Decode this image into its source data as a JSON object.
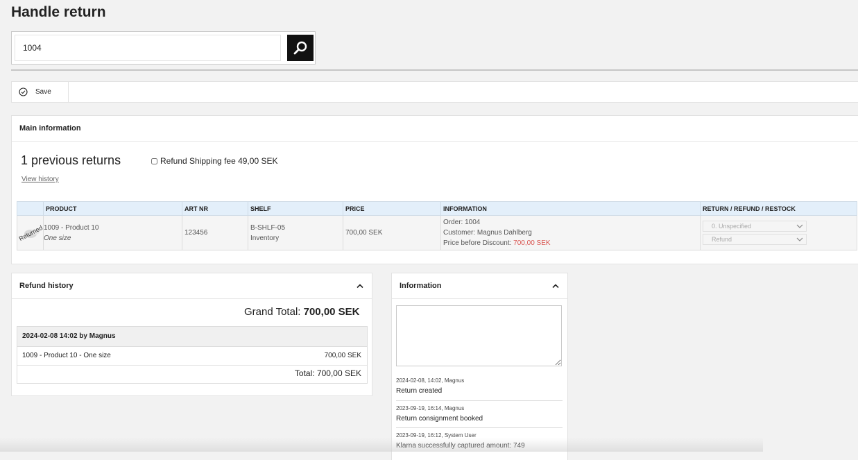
{
  "page": {
    "title": "Handle return"
  },
  "search": {
    "value": "1004"
  },
  "toolbar": {
    "save_label": "Save"
  },
  "main_info": {
    "header": "Main information",
    "previous_returns": "1 previous returns",
    "view_history": "View history",
    "refund_shipping_label": "Refund Shipping fee 49,00 SEK",
    "table": {
      "headers": [
        "",
        "PRODUCT",
        "ART NR",
        "SHELF",
        "PRICE",
        "INFORMATION",
        "RETURN / REFUND / RESTOCK"
      ],
      "rows": [
        {
          "stamp": "Returned",
          "product_name": "1009 - Product 10",
          "product_variant": "One size",
          "art_nr": "123456",
          "shelf_code": "B-SHLF-05",
          "shelf_type": "Inventory",
          "price": "700,00 SEK",
          "info_order": "Order: 1004",
          "info_customer": "Customer: Magnus Dahlberg",
          "info_price_before_label": "Price before Discount:",
          "info_price_before_value": "700,00 SEK",
          "return_reason": "0. Unspecified",
          "refund_action": "Refund"
        }
      ]
    }
  },
  "refund_history": {
    "header": "Refund history",
    "grand_total_label": "Grand Total:",
    "grand_total_value": "700,00 SEK",
    "entry_header": "2024-02-08 14:02 by Magnus",
    "line_item": "1009 - Product 10 - One size",
    "line_amount": "700,00 SEK",
    "total": "Total: 700,00 SEK"
  },
  "information": {
    "header": "Information",
    "log": [
      {
        "meta": "2024-02-08, 14:02, Magnus",
        "msg": "Return created"
      },
      {
        "meta": "2023-09-19, 16:14, Magnus",
        "msg": "Return consignment booked"
      },
      {
        "meta": "2023-09-19, 16:12, System User",
        "msg": "Klarna successfully captured amount: 749"
      }
    ]
  },
  "colors": {
    "accent_bg": "#111111",
    "header_row": "#e3effa",
    "discount_price": "#d9534f"
  },
  "icons": {
    "search": "search-icon",
    "save": "check-circle-icon",
    "collapse": "chevron-up-icon",
    "dropdown": "chevron-down-icon"
  }
}
